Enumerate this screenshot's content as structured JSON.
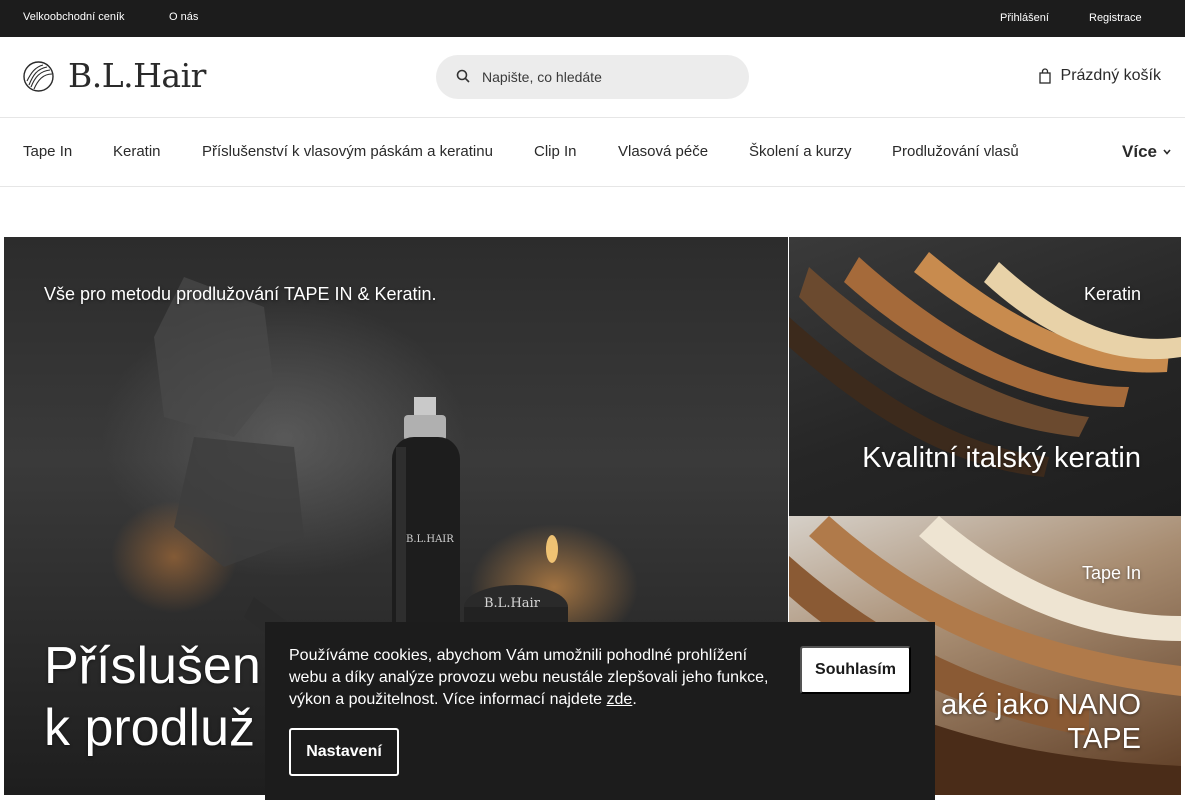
{
  "topbar": {
    "left_links": [
      "Velkoobchodní ceník",
      "O nás"
    ],
    "right_links": [
      "Přihlášení",
      "Registrace"
    ]
  },
  "header": {
    "logo_text": "B.L.Hair",
    "search_placeholder": "Napište, co hledáte",
    "cart_label": "Prázdný košík"
  },
  "nav": {
    "items": [
      "Tape In",
      "Keratin",
      "Příslušenství k vlasovým páskám a keratinu",
      "Clip In",
      "Vlasová péče",
      "Školení a kurzy",
      "Prodlužování vlasů"
    ],
    "more_label": "Více"
  },
  "banners": {
    "main": {
      "subtitle": "Vše pro metodu prodlužování TAPE IN & Keratin.",
      "title_line1": "Příslušen",
      "title_line2": "k prodluž",
      "product_text": [
        "B.L.HAIR",
        "B.L.Hair"
      ]
    },
    "keratin": {
      "tag": "Keratin",
      "title": "Kvalitní italský keratin"
    },
    "tape": {
      "tag": "Tape In",
      "title_line1": "aké jako NANO",
      "title_line2": "TAPE"
    }
  },
  "cookie": {
    "message": "Používáme cookies, abychom Vám umožnili pohodlné prohlížení webu a díky analýze provozu webu neustále zlepšovali jeho funkce, výkon a použitelnost. Více informací najdete ",
    "link_text": "zde",
    "message_end": ".",
    "accept_label": "Souhlasím",
    "settings_label": "Nastavení"
  },
  "colors": {
    "topbar_bg": "#1c1c1c",
    "search_bg": "#ececec",
    "cookie_bg": "#1c1c1c"
  }
}
